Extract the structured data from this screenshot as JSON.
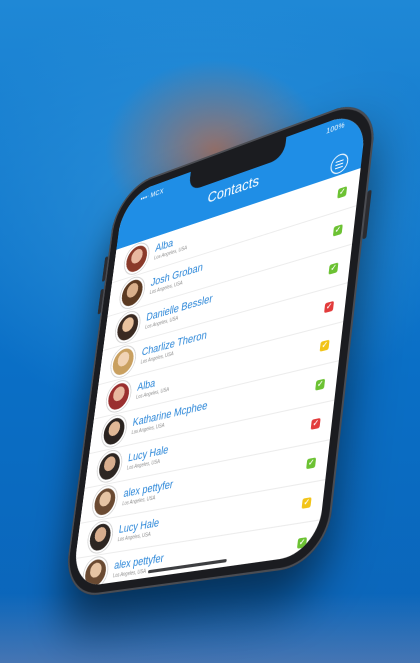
{
  "status_bar": {
    "carrier": "▪▪▪ᐧ MCX",
    "battery": "100%"
  },
  "header": {
    "title": "Contacts"
  },
  "contacts": [
    {
      "name": "Alba",
      "location": "Los Angeles, USA",
      "status": "green",
      "status_glyph": "✓"
    },
    {
      "name": "Josh Groban",
      "location": "Los Angeles, USA",
      "status": "green",
      "status_glyph": "✓"
    },
    {
      "name": "Danielle Bessler",
      "location": "Los Angeles, USA",
      "status": "green",
      "status_glyph": "✓"
    },
    {
      "name": "Charlize Theron",
      "location": "Los Angeles, USA",
      "status": "red",
      "status_glyph": "✓"
    },
    {
      "name": "Alba",
      "location": "Los Angeles, USA",
      "status": "yellow",
      "status_glyph": "✓"
    },
    {
      "name": "Katharine Mcphee",
      "location": "Los Angeles, USA",
      "status": "green",
      "status_glyph": "✓"
    },
    {
      "name": "Lucy Hale",
      "location": "Los Angeles, USA",
      "status": "red",
      "status_glyph": "✓"
    },
    {
      "name": "alex pettyfer",
      "location": "Los Angeles, USA",
      "status": "green",
      "status_glyph": "✓"
    },
    {
      "name": "Lucy Hale",
      "location": "Los Angeles, USA",
      "status": "yellow",
      "status_glyph": "✓"
    },
    {
      "name": "alex pettyfer",
      "location": "Los Angeles, USA",
      "status": "green",
      "status_glyph": "✓"
    }
  ],
  "extra_status": {
    "status": "yellow",
    "status_glyph": "✓"
  },
  "colors": {
    "accent": "#1f8ee6",
    "green": "#6cc233",
    "red": "#e23b3b",
    "yellow": "#f2c418"
  }
}
